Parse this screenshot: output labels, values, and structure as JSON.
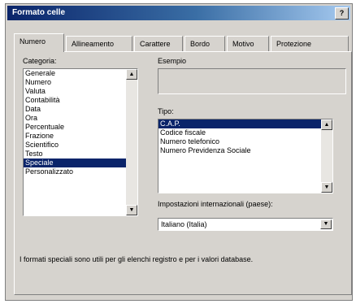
{
  "window": {
    "title": "Formato celle",
    "help_label": "?"
  },
  "tabs": [
    "Numero",
    "Allineamento",
    "Carattere",
    "Bordo",
    "Motivo",
    "Protezione"
  ],
  "category": {
    "label": "Categoria:",
    "items": [
      "Generale",
      "Numero",
      "Valuta",
      "Contabilità",
      "Data",
      "Ora",
      "Percentuale",
      "Frazione",
      "Scientifico",
      "Testo",
      "Speciale",
      "Personalizzato"
    ],
    "selected": "Speciale"
  },
  "sample": {
    "label": "Esempio"
  },
  "type": {
    "label": "Tipo:",
    "items": [
      "C.A.P.",
      "Codice fiscale",
      "Numero telefonico",
      "Numero Previdenza Sociale"
    ],
    "selected": "C.A.P."
  },
  "locale": {
    "label": "Impostazioni internazionali (paese):",
    "value": "Italiano (Italia)"
  },
  "description": "I formati speciali sono utili per gli elenchi registro e per i valori database."
}
